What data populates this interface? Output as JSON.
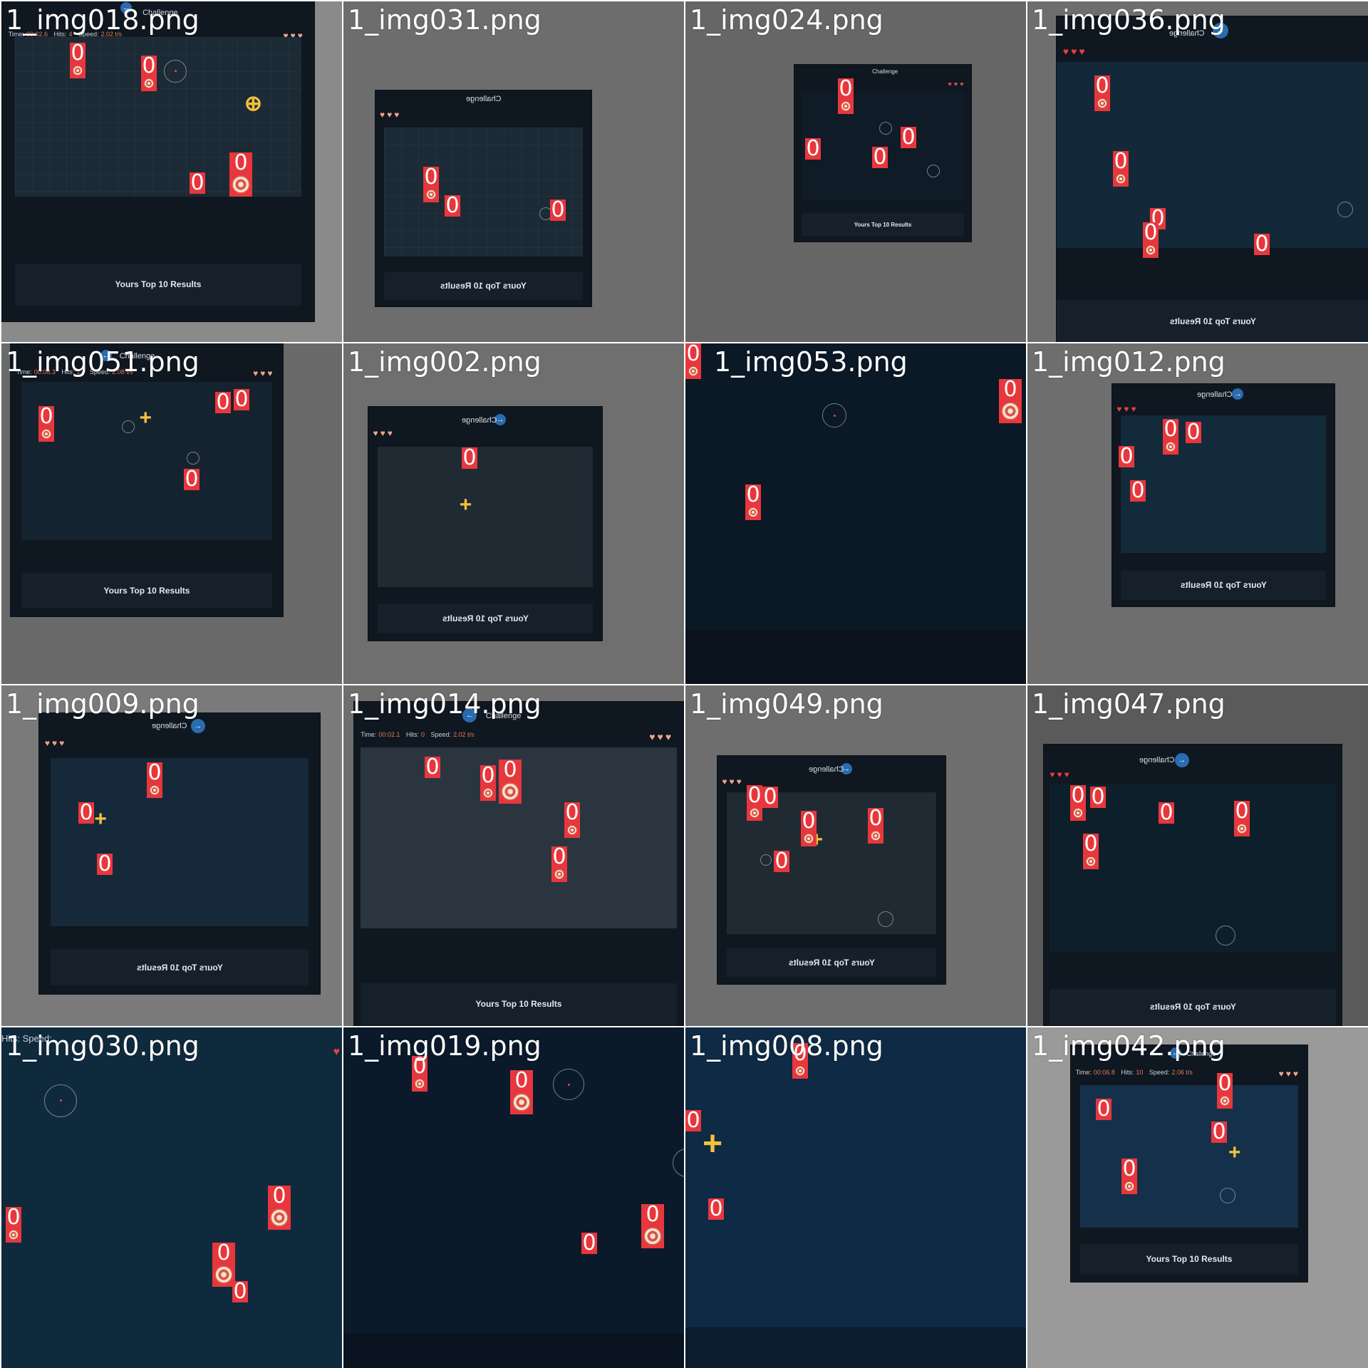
{
  "tiles": [
    {
      "name": "1_img018.png"
    },
    {
      "name": "1_img031.png"
    },
    {
      "name": "1_img024.png"
    },
    {
      "name": "1_img036.png"
    },
    {
      "name": "1_img051.png"
    },
    {
      "name": "1_img002.png"
    },
    {
      "name": "1_img053.png"
    },
    {
      "name": "1_img012.png"
    },
    {
      "name": "1_img009.png"
    },
    {
      "name": "1_img014.png"
    },
    {
      "name": "1_img049.png"
    },
    {
      "name": "1_img047.png"
    },
    {
      "name": "1_img030.png"
    },
    {
      "name": "1_img019.png"
    },
    {
      "name": "1_img008.png"
    },
    {
      "name": "1_img042.png"
    }
  ],
  "game": {
    "challenge": "Challenge",
    "back_icon": "arrow-left-icon",
    "time_label": "Time:",
    "hits_label": "Hits:",
    "speed_label": "Speed:",
    "results_label": "Yours Top 10 Results",
    "heart_icon": "heart-icon",
    "crosshair_icon": "crosshair-icon"
  },
  "stats": {
    "t018": {
      "time": "00:02.6",
      "hits": "4",
      "speed": "2.02 t/s"
    },
    "t051": {
      "time": "00:08.3",
      "hits": "13",
      "speed": "2.08 t/s"
    },
    "t014": {
      "time": "00:02.1",
      "hits": "0",
      "speed": "2.02 t/s"
    },
    "t042": {
      "time": "00:06.8",
      "hits": "10",
      "speed": "2.06 t/s"
    }
  },
  "detection_label": "0",
  "colors": {
    "detection": "#e8373c",
    "heart": "#f3a38c",
    "crosshair": "#f3c23a",
    "arena": "#1c2a36"
  }
}
